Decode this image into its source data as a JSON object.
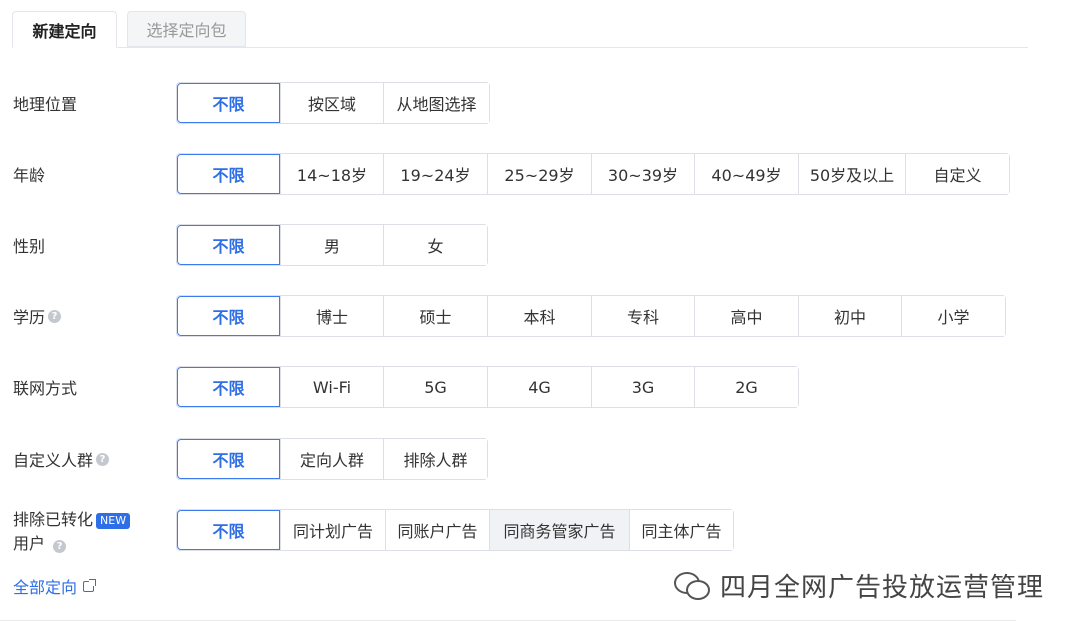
{
  "tabs": {
    "active": "新建定向",
    "inactive": "选择定向包"
  },
  "rows": {
    "geo": {
      "label": "地理位置",
      "options": [
        "不限",
        "按区域",
        "从地图选择"
      ],
      "selected": 0
    },
    "age": {
      "label": "年龄",
      "options": [
        "不限",
        "14~18岁",
        "19~24岁",
        "25~29岁",
        "30~39岁",
        "40~49岁",
        "50岁及以上",
        "自定义"
      ],
      "selected": 0
    },
    "gender": {
      "label": "性别",
      "options": [
        "不限",
        "男",
        "女"
      ],
      "selected": 0
    },
    "education": {
      "label": "学历",
      "options": [
        "不限",
        "博士",
        "硕士",
        "本科",
        "专科",
        "高中",
        "初中",
        "小学"
      ],
      "selected": 0
    },
    "network": {
      "label": "联网方式",
      "options": [
        "不限",
        "Wi-Fi",
        "5G",
        "4G",
        "3G",
        "2G"
      ],
      "selected": 0
    },
    "audience": {
      "label": "自定义人群",
      "options": [
        "不限",
        "定向人群",
        "排除人群"
      ],
      "selected": 0
    },
    "exclude": {
      "label_line1": "排除已转化",
      "badge": "NEW",
      "label_line2": "用户",
      "options": [
        "不限",
        "同计划广告",
        "同账户广告",
        "同商务管家广告",
        "同主体广告"
      ],
      "selected": 0
    }
  },
  "help_icon": "?",
  "all_targeting_link": "全部定向",
  "watermark": "四月全网广告投放运营管理",
  "colors": {
    "accent": "#2e6ee6",
    "border": "#dcdfe6"
  }
}
